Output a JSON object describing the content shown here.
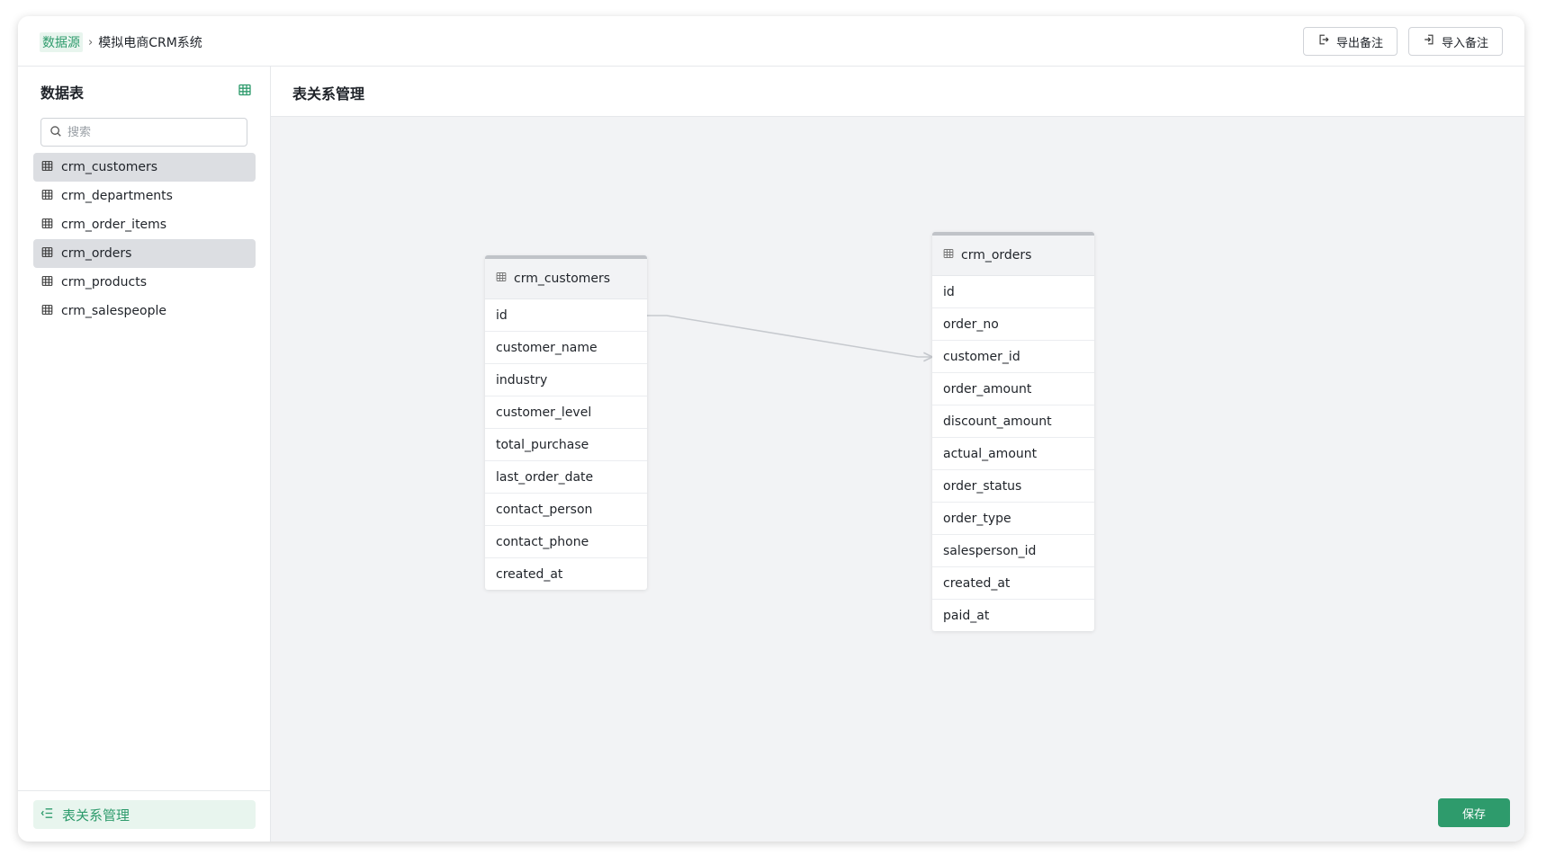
{
  "breadcrumb": {
    "root": "数据源",
    "current": "模拟电商CRM系统"
  },
  "top_actions": {
    "export_label": "导出备注",
    "import_label": "导入备注"
  },
  "sidebar": {
    "title": "数据表",
    "search_placeholder": "搜索",
    "tables": [
      {
        "name": "crm_customers",
        "selected": true
      },
      {
        "name": "crm_departments",
        "selected": false
      },
      {
        "name": "crm_order_items",
        "selected": false
      },
      {
        "name": "crm_orders",
        "selected": true
      },
      {
        "name": "crm_products",
        "selected": false
      },
      {
        "name": "crm_salespeople",
        "selected": false
      }
    ],
    "relation_button": "表关系管理"
  },
  "main": {
    "title": "表关系管理",
    "save_label": "保存",
    "er_tables": [
      {
        "name": "crm_customers",
        "fields": [
          "id",
          "customer_name",
          "industry",
          "customer_level",
          "total_purchase",
          "last_order_date",
          "contact_person",
          "contact_phone",
          "created_at"
        ]
      },
      {
        "name": "crm_orders",
        "fields": [
          "id",
          "order_no",
          "customer_id",
          "order_amount",
          "discount_amount",
          "actual_amount",
          "order_status",
          "order_type",
          "salesperson_id",
          "created_at",
          "paid_at"
        ]
      }
    ],
    "relations": [
      {
        "from_table": "crm_customers",
        "from_field": "id",
        "to_table": "crm_orders",
        "to_field": "customer_id"
      }
    ]
  },
  "colors": {
    "accent": "#2e9b6c",
    "accent_bg": "#e8f5ee",
    "selected_bg": "#dcdee2",
    "canvas_bg": "#f2f3f5"
  }
}
